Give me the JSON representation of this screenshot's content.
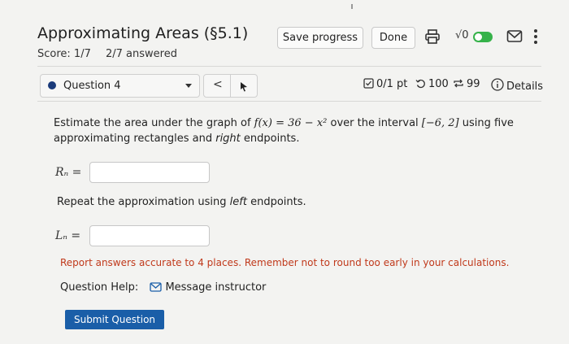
{
  "header": {
    "title": "Approximating Areas (§5.1)",
    "score_label": "Score: 1/7",
    "answered": "2/7 answered",
    "save_label": "Save progress",
    "done_label": "Done",
    "sqrt_label": "√0"
  },
  "question_bar": {
    "question_label": "Question 4",
    "prev_symbol": "<",
    "points": "0/1 pt",
    "retries": "100",
    "attempts": "99",
    "details_label": "Details"
  },
  "question": {
    "prompt_prefix": "Estimate the area under the graph of ",
    "function": "f(x) = 36 − x²",
    "prompt_middle": " over the interval ",
    "interval": "[−6, 2]",
    "prompt_suffix": " using five approximating rectangles and ",
    "endpoint_word": "right",
    "prompt_end": " endpoints.",
    "rn_label": "Rₙ =",
    "rn_value": "",
    "repeat_prefix": "Repeat the approximation using ",
    "repeat_word": "left",
    "repeat_suffix": " endpoints.",
    "ln_label": "Lₙ =",
    "ln_value": "",
    "note": "Report answers accurate to 4 places. Remember not to round too early in your calculations.",
    "help_label": "Question Help:",
    "message_label": "Message instructor",
    "submit_label": "Submit Question"
  },
  "colors": {
    "accent": "#1a5ea8",
    "note": "#c0391b",
    "toggle": "#36b24a"
  }
}
